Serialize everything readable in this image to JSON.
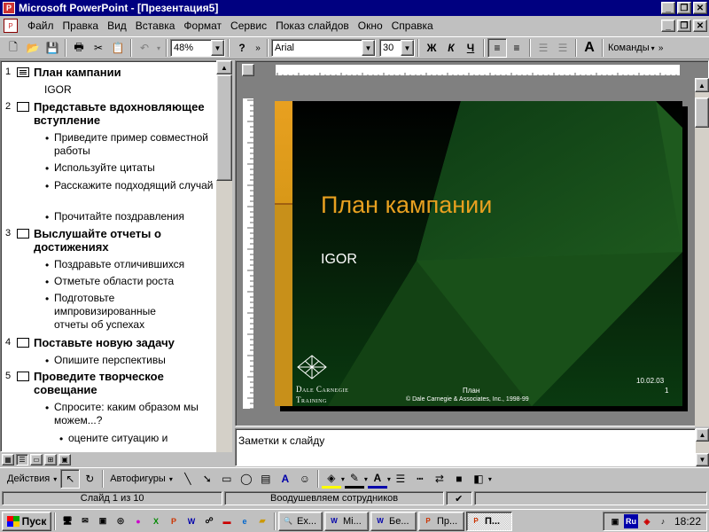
{
  "window": {
    "title": "Microsoft PowerPoint - [Презентация5]"
  },
  "menu": {
    "items": [
      "Файл",
      "Правка",
      "Вид",
      "Вставка",
      "Формат",
      "Сервис",
      "Показ слайдов",
      "Окно",
      "Справка"
    ]
  },
  "toolbar": {
    "zoom": "48%",
    "font": "Arial",
    "font_size": "30",
    "bold": "Ж",
    "italic": "К",
    "underline": "Ч",
    "commands": "Команды"
  },
  "outline": {
    "slides": [
      {
        "num": "1",
        "title": "План кампании",
        "sub": "IGOR",
        "bullets": []
      },
      {
        "num": "2",
        "title": "Представьте вдохновляющее вступление",
        "bullets": [
          "Приведите пример совместной работы",
          "Используйте цитаты",
          "Расскажите подходящий случай",
          "Прочитайте поздравления"
        ]
      },
      {
        "num": "3",
        "title": "Выслушайте отчеты о достижениях",
        "bullets": [
          "Поздравьте отличившихся",
          "Отметьте области роста",
          "Подготовьте импровизированные отчеты об успехах"
        ]
      },
      {
        "num": "4",
        "title": "Поставьте новую задачу",
        "bullets": [
          "Опишите перспективы"
        ]
      },
      {
        "num": "5",
        "title": "Проведите творческое совещание",
        "bullets": [
          "Спросите:  каким образом мы можем...?"
        ],
        "sub_bullets": [
          "оцените ситуацию и"
        ]
      }
    ]
  },
  "slide": {
    "title": "План кампании",
    "subtitle": "IGOR",
    "footer_center": "План",
    "copyright": "© Dale Carnegie & Associates, Inc., 1998-99",
    "date": "10.02.03",
    "number": "1",
    "logo_line1": "Dale Carnegie",
    "logo_line2": "Training",
    "colors": {
      "background": "#0a2a10",
      "accent": "#e8a020",
      "diamond": "#1e5a1e"
    }
  },
  "notes": {
    "placeholder": "Заметки к слайду"
  },
  "drawbar": {
    "actions": "Действия",
    "autoshapes": "Автофигуры"
  },
  "status": {
    "slide": "Слайд 1 из 10",
    "design": "Воодушевляем сотрудников"
  },
  "taskbar": {
    "start": "Пуск",
    "tasks": [
      "Ex...",
      "Mi...",
      "Бе...",
      "Пр...",
      "П..."
    ],
    "lang": "Ru",
    "clock": "18:22"
  }
}
